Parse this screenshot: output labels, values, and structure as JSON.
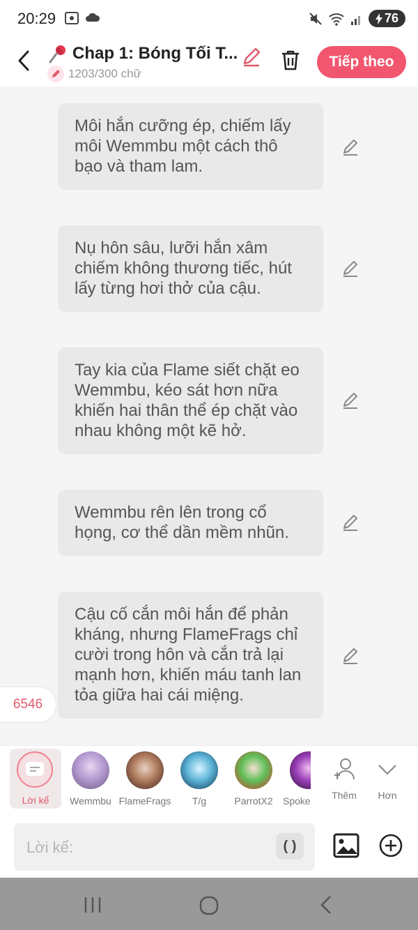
{
  "status_bar": {
    "time": "20:29",
    "battery": "76"
  },
  "header": {
    "title": "Chap 1: Bóng Tối T...",
    "word_count": "1203/300 chữ",
    "next_label": "Tiếp theo",
    "accent": "#f2566f"
  },
  "messages": [
    "Môi hắn cưỡng ép, chiếm lấy môi Wemmbu một cách thô bạo và tham lam.",
    "Nụ hôn sâu, lưỡi hắn xâm chiếm không thương tiếc, hút lấy từng hơi thở của cậu.",
    "Tay kia của Flame siết chặt eo Wemmbu, kéo sát hơn nữa khiến hai thân thể ép chặt vào nhau không một kẽ hở.",
    "Wemmbu rên lên trong cổ họng, cơ thể dần mềm nhũn.",
    "Cậu cố cắn môi hắn để phản kháng, nhưng FlameFrags chỉ cười trong hôn và cắn trả lại mạnh hơn, khiến máu tanh lan tỏa giữa hai cái miệng."
  ],
  "counter": "6546",
  "characters": {
    "narrator": "Lời kể",
    "list": [
      "Wemmbu",
      "FlameFrags",
      "T/g",
      "ParrotX2",
      "Spoke"
    ],
    "add_label": "Thêm",
    "more_label": "Hơn"
  },
  "input": {
    "placeholder": "Lời kể:",
    "paren_button": "( )"
  }
}
